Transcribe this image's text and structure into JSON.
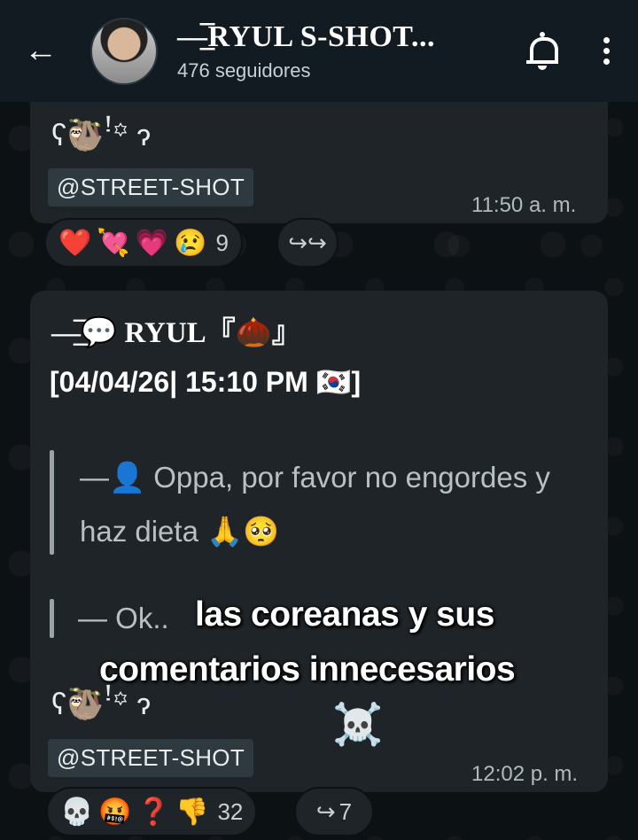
{
  "header": {
    "title": "—̲̅RYUL S-SHOT...",
    "subtitle": "476 seguidores",
    "back_icon": "←"
  },
  "message1": {
    "signature": "ʕ🦥ꜝ꙳ ɂ",
    "tag": "@STREET-SHOT",
    "time": "11:50 a. m.",
    "reactions": [
      "❤️",
      "💘",
      "💗",
      "😢"
    ],
    "reaction_count": "9",
    "forward_icon": "↪↪"
  },
  "message2": {
    "author": "—̲̅💬 RYUL『🌰』",
    "date": "[04/04/26| 15:10 PM 🇰🇷]",
    "quote1_line1": "—👤 Oppa, por favor no engordes y",
    "quote1_line2": "haz dieta 🙏🥺",
    "quote2": "— Ok..",
    "signature": "ʕ🦥ꜝ꙳ ɂ",
    "tag": "@STREET-SHOT",
    "time": "12:02 p. m.",
    "reactions": [
      "💀",
      "🤬",
      "❓",
      "👎"
    ],
    "reaction_count": "32",
    "forward_count": "7"
  },
  "caption": {
    "line1": "las coreanas y sus",
    "line2": "comentarios innecesarios",
    "emoji": "☠️"
  },
  "colors": {
    "header_bg": "#121b22",
    "bubble_bg": "#1e2428",
    "tag_bg": "#2f3a40"
  }
}
